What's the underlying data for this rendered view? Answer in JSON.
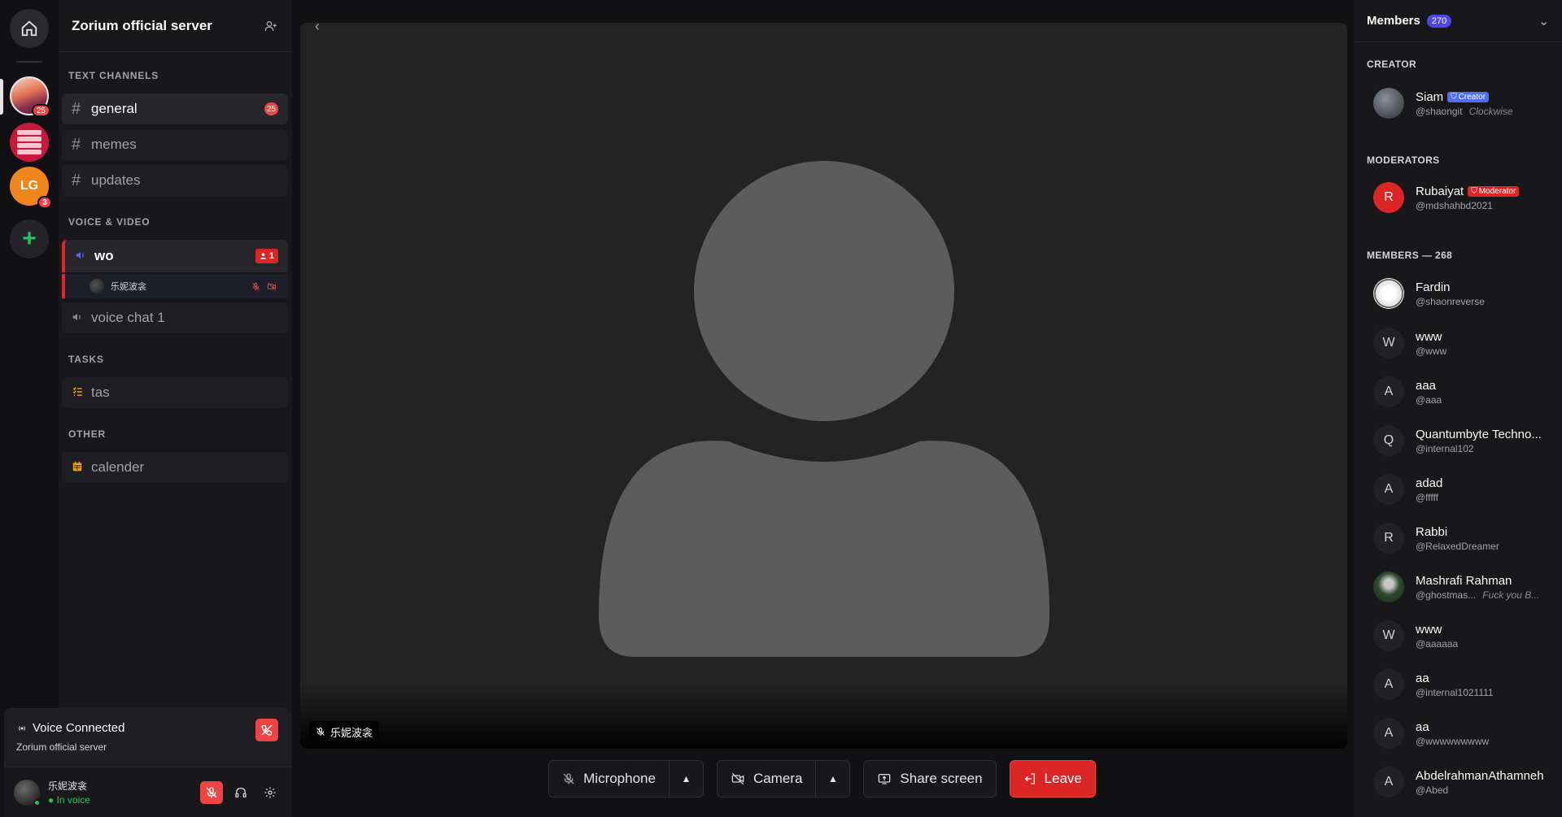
{
  "rail": {
    "servers": [
      {
        "name": "server-1",
        "badge": "25"
      },
      {
        "name": "server-2",
        "badge": ""
      },
      {
        "name": "server-3",
        "initials": "LG",
        "badge": "3"
      }
    ],
    "add_label": "+"
  },
  "sidebar": {
    "server_name": "Zorium official server",
    "sections": {
      "text": "TEXT CHANNELS",
      "voice": "VOICE & VIDEO",
      "tasks": "TASKS",
      "other": "OTHER"
    },
    "text_channels": [
      {
        "label": "general",
        "badge": "25"
      },
      {
        "label": "memes"
      },
      {
        "label": "updates"
      }
    ],
    "voice_channels": [
      {
        "label": "wo",
        "count": "1",
        "users": [
          {
            "name": "乐妮波衾"
          }
        ]
      },
      {
        "label": "voice chat 1"
      }
    ],
    "tasks": [
      {
        "label": "tas"
      }
    ],
    "other": [
      {
        "label": "calender"
      }
    ]
  },
  "voice_panel": {
    "title": "Voice Connected",
    "server": "Zorium official server"
  },
  "user": {
    "name": "乐妮波衾",
    "status": "In voice"
  },
  "stage": {
    "participant": "乐妮波衾"
  },
  "controls": {
    "microphone": "Microphone",
    "camera": "Camera",
    "share": "Share screen",
    "leave": "Leave"
  },
  "members": {
    "title": "Members",
    "count": "270",
    "creator_section": "CREATOR",
    "mod_section": "MODERATORS",
    "members_section": "MEMBERS — 268",
    "creator": {
      "name": "Siam",
      "handle": "@shaongit",
      "status": "Clockwise",
      "role": "Creator"
    },
    "moderator": {
      "name": "Rubaiyat",
      "handle": "@mdshahbd2021",
      "role": "Moderator",
      "initial": "R"
    },
    "list": [
      {
        "name": "Fardin",
        "handle": "@shaonreverse",
        "initial": ""
      },
      {
        "name": "www",
        "handle": "@www",
        "initial": "W"
      },
      {
        "name": "aaa",
        "handle": "@aaa",
        "initial": "A"
      },
      {
        "name": "Quantumbyte Techno...",
        "handle": "@internal102",
        "initial": "Q"
      },
      {
        "name": "adad",
        "handle": "@fffff",
        "initial": "A"
      },
      {
        "name": "Rabbi",
        "handle": "@RelaxedDreamer",
        "initial": "R"
      },
      {
        "name": "Mashrafi Rahman",
        "handle": "@ghostmas...",
        "status": "Fuck you B...",
        "initial": ""
      },
      {
        "name": "www",
        "handle": "@aaaaaa",
        "initial": "W"
      },
      {
        "name": "aa",
        "handle": "@internal1021111",
        "initial": "A"
      },
      {
        "name": "aa",
        "handle": "@wwwwwwwww",
        "initial": "A"
      },
      {
        "name": "AbdelrahmanAthamneh",
        "handle": "@Abed",
        "initial": "A"
      }
    ]
  },
  "colors": {
    "accent": "#4f46e5",
    "danger": "#dc2626",
    "online": "#22c55e"
  }
}
